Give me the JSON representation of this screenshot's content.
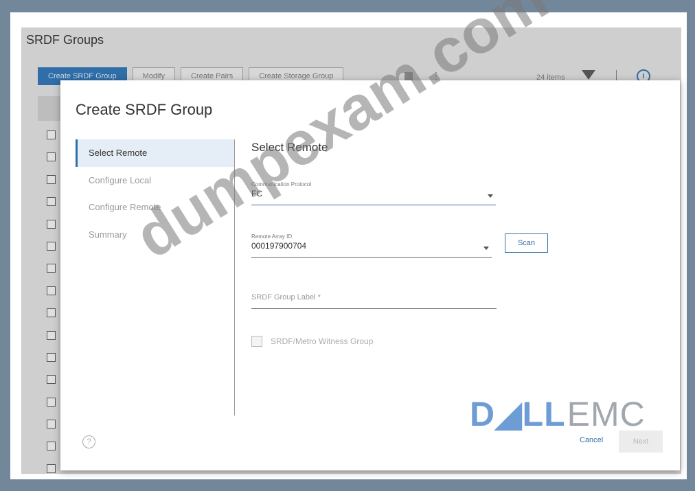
{
  "app": {
    "page_title": "SRDF Groups"
  },
  "toolbar": {
    "create_label": "Create SRDF Group",
    "modify_label": "Modify",
    "create_pairs_label": "Create Pairs",
    "create_storage_label": "Create Storage Group",
    "item_count": "24 items"
  },
  "dialog": {
    "title": "Create SRDF Group",
    "steps": [
      {
        "label": "Select Remote",
        "active": true
      },
      {
        "label": "Configure Local",
        "active": false
      },
      {
        "label": "Configure Remote",
        "active": false
      },
      {
        "label": "Summary",
        "active": false
      }
    ],
    "section_title": "Select Remote",
    "protocol": {
      "label": "Communication Protocol",
      "value": "FC"
    },
    "remote_array": {
      "label": "Remote Array ID",
      "value": "000197900704"
    },
    "scan_label": "Scan",
    "group_label": {
      "placeholder": "SRDF Group Label *"
    },
    "witness": {
      "label": "SRDF/Metro Witness Group",
      "checked": false
    },
    "cancel_label": "Cancel",
    "next_label": "Next"
  },
  "watermark": {
    "text": "dumpexam.com"
  },
  "brand": {
    "dell": "D◢LL",
    "emc": "EMC"
  }
}
